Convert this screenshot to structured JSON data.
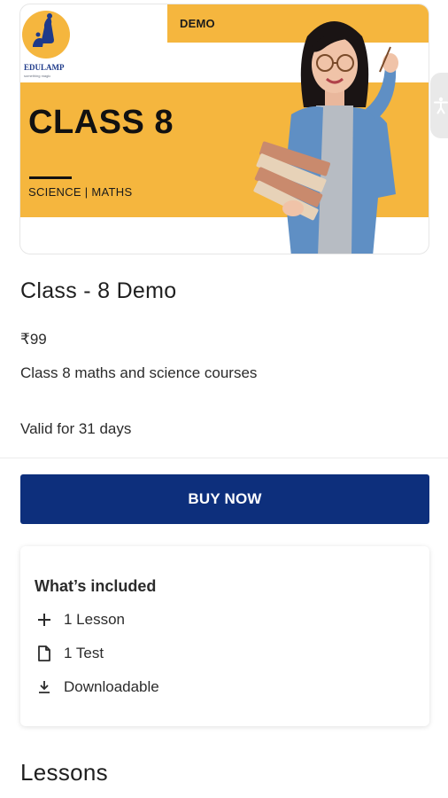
{
  "banner": {
    "tag": "DEMO",
    "title": "CLASS 8",
    "subjects": "SCIENCE | MATHS",
    "logo_text": "EDULAMP",
    "logo_tagline": "something magic"
  },
  "course": {
    "title": "Class - 8 Demo",
    "price": "₹99",
    "description": "Class 8 maths and science courses",
    "validity": "Valid for 31 days"
  },
  "buy_button": {
    "label": "BUY NOW"
  },
  "included": {
    "heading": "What’s included",
    "items": [
      {
        "icon": "plus-icon",
        "label": "1 Lesson"
      },
      {
        "icon": "document-icon",
        "label": "1 Test"
      },
      {
        "icon": "download-icon",
        "label": "Downloadable"
      }
    ]
  },
  "lessons": {
    "heading": "Lessons"
  },
  "colors": {
    "accent_yellow": "#f5b63e",
    "primary_button": "#0d2f7c",
    "logo_blue": "#1e3a8a"
  }
}
